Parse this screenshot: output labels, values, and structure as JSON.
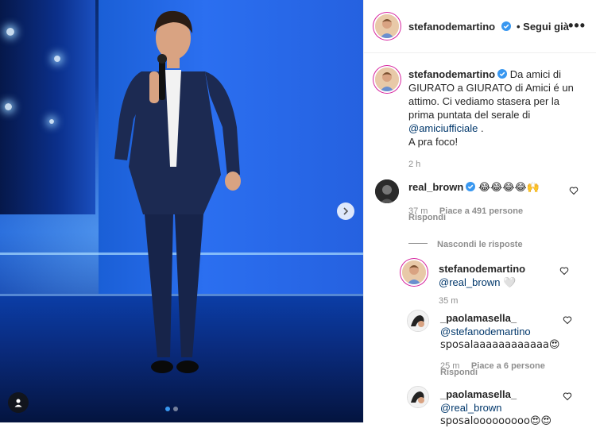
{
  "post": {
    "author": "stefanodemartino",
    "follow_label": "• Segui già",
    "more_label": "•••",
    "caption_username": "stefanodemartino",
    "caption_text_1": "Da amici di",
    "caption_text_2": "GIURATO a GIURATO di Amici é un",
    "caption_text_3": "attimo. Ci vediamo stasera per la",
    "caption_text_4": "prima puntata del serale di",
    "caption_mention": "@amiciufficiale",
    "caption_text_5": ".",
    "caption_text_6": "A pra foco!",
    "caption_time": "2 h"
  },
  "comments": [
    {
      "username": "real_brown",
      "text": "😂😂😂😂🙌",
      "time": "37 m",
      "likes": "Piace a 491 persone",
      "reply": "Rispondi",
      "hide_replies": "Nascondi le risposte"
    }
  ],
  "replies": [
    {
      "username": "stefanodemartino",
      "mention": "@real_brown",
      "text": "🤍",
      "time": "35 m"
    },
    {
      "username": "_paolamasella_",
      "mention": "@stefanodemartino",
      "text": "sposalaaaaaaaaaaaa😍",
      "time": "25 m",
      "likes": "Piace a 6 persone",
      "reply": "Rispondi"
    },
    {
      "username": "_paolamasella_",
      "mention": "@real_brown",
      "text": "sposalooooooooo😍😍"
    }
  ],
  "colors": {
    "accent": "#3897f0",
    "link": "#00376b",
    "muted": "#8e8e8e",
    "like_red": "#ed4956"
  }
}
